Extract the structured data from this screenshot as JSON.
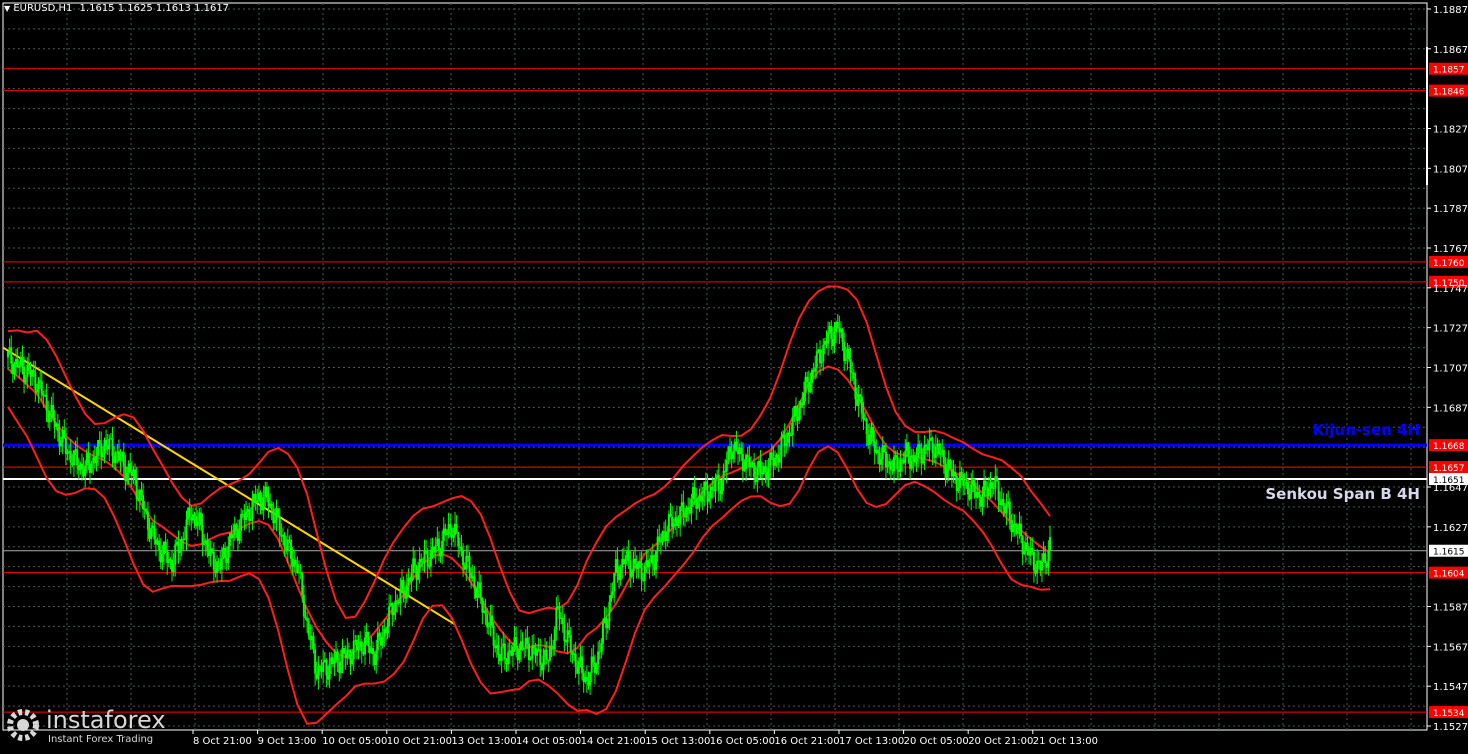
{
  "header": {
    "symbol_label": "EURUSD,H1",
    "ohlc": "1.1615 1.1625 1.1613 1.1617"
  },
  "watermark": {
    "brand": "instaforex",
    "tagline": "Instant Forex Trading"
  },
  "colors": {
    "background": "#000000",
    "grid": "#4a5a5a",
    "candles": "#00ff00",
    "bollinger": "#ff1e1e",
    "level_line": "#ff0000",
    "kijun_line": "#0000ff",
    "senkou_line": "#ffffff",
    "trend_line": "#ffd700",
    "level_label_bg": "#ff0000"
  },
  "chart_data": {
    "type": "candlestick",
    "symbol": "EURUSD",
    "timeframe": "H1",
    "ylim": [
      1.1525,
      1.189
    ],
    "y_ticks": [
      "1.1887",
      "1.1867",
      "1.1827",
      "1.1807",
      "1.1787",
      "1.1767",
      "1.1747",
      "1.1727",
      "1.1707",
      "1.1687",
      "1.1647",
      "1.1627",
      "1.1587",
      "1.1567",
      "1.1547",
      "1.1527"
    ],
    "x_ticks": [
      "8 Oct 21:00",
      "9 Oct 13:00",
      "10 Oct 05:00",
      "10 Oct 21:00",
      "13 Oct 13:00",
      "14 Oct 05:00",
      "14 Oct 21:00",
      "15 Oct 13:00",
      "16 Oct 05:00",
      "16 Oct 21:00",
      "17 Oct 13:00",
      "20 Oct 05:00",
      "20 Oct 21:00",
      "21 Oct 13:00"
    ],
    "levels": [
      {
        "label": "1.1857",
        "value": 1.1857,
        "kind": "resistance"
      },
      {
        "label": "1.1846",
        "value": 1.1846,
        "kind": "resistance"
      },
      {
        "label": "1.1760",
        "value": 1.176,
        "kind": "resistance"
      },
      {
        "label": "1.1750",
        "value": 1.175,
        "kind": "resistance"
      },
      {
        "label": "1.1668",
        "value": 1.1668,
        "kind": "kijun"
      },
      {
        "label": "1.1657",
        "value": 1.1657,
        "kind": "level"
      },
      {
        "label": "1.1651",
        "value": 1.1651,
        "kind": "senkou"
      },
      {
        "label": "1.1615",
        "value": 1.1615,
        "kind": "current"
      },
      {
        "label": "1.1604",
        "value": 1.1604,
        "kind": "support"
      },
      {
        "label": "1.1534",
        "value": 1.1534,
        "kind": "support"
      }
    ],
    "annotations": [
      {
        "text": "Kijun-sen 4H",
        "value": 1.1668
      },
      {
        "text": "Senkou Span B 4H",
        "value": 1.1651
      }
    ],
    "price_path": [
      1.1712,
      1.1708,
      1.1705,
      1.17,
      1.1688,
      1.1677,
      1.1666,
      1.166,
      1.1656,
      1.1662,
      1.1669,
      1.1665,
      1.1658,
      1.1652,
      1.1637,
      1.1622,
      1.1614,
      1.1609,
      1.162,
      1.1635,
      1.1626,
      1.1611,
      1.1607,
      1.162,
      1.1628,
      1.1635,
      1.1642,
      1.164,
      1.1628,
      1.1616,
      1.1607,
      1.1578,
      1.1555,
      1.1556,
      1.156,
      1.1562,
      1.1566,
      1.1569,
      1.1563,
      1.1575,
      1.1588,
      1.1595,
      1.1605,
      1.161,
      1.1614,
      1.162,
      1.1628,
      1.1614,
      1.1603,
      1.159,
      1.1576,
      1.1562,
      1.1564,
      1.1567,
      1.1566,
      1.1562,
      1.156,
      1.1585,
      1.157,
      1.1558,
      1.155,
      1.156,
      1.158,
      1.1605,
      1.161,
      1.1607,
      1.1605,
      1.1612,
      1.1625,
      1.163,
      1.1634,
      1.164,
      1.1643,
      1.1646,
      1.165,
      1.1668,
      1.1662,
      1.1657,
      1.1654,
      1.1658,
      1.1665,
      1.1675,
      1.1687,
      1.17,
      1.1712,
      1.1722,
      1.1727,
      1.1712,
      1.1693,
      1.1676,
      1.1665,
      1.166,
      1.1657,
      1.1663,
      1.1661,
      1.1666,
      1.1668,
      1.166,
      1.1652,
      1.1649,
      1.1645,
      1.1642,
      1.165,
      1.164,
      1.163,
      1.1621,
      1.1612,
      1.1606,
      1.1617
    ],
    "trend_line": {
      "start": 1.1717,
      "end": 1.1578,
      "description": "descending"
    }
  }
}
